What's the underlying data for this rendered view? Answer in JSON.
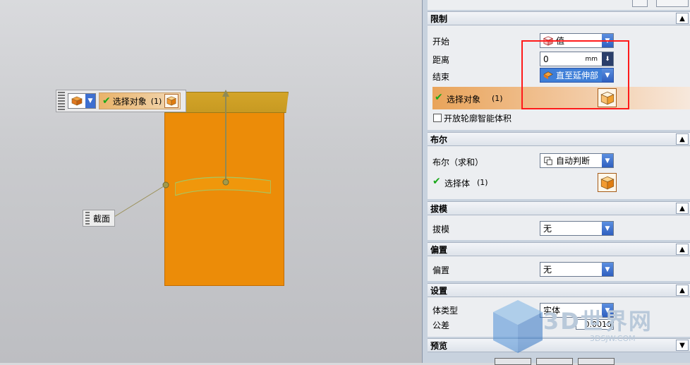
{
  "float_bar": {
    "select_label": "选择对象",
    "select_count": "(1)"
  },
  "section_tag": {
    "label": "截面"
  },
  "limits": {
    "title": "限制",
    "start_label": "开始",
    "start_value": "值",
    "distance_label": "距离",
    "distance_value": "0",
    "distance_unit": "mm",
    "end_label": "结束",
    "end_value": "直至延伸部",
    "select_label": "选择对象",
    "select_count": "(1)",
    "open_profile_label": "开放轮廓智能体积"
  },
  "boolean": {
    "title": "布尔",
    "bool_label": "布尔（求和）",
    "bool_value": "自动判断",
    "select_label": "选择体",
    "select_count": "(1)"
  },
  "draft": {
    "title": "拔模",
    "label": "拔模",
    "value": "无"
  },
  "offset": {
    "title": "偏置",
    "label": "偏置",
    "value": "无"
  },
  "settings": {
    "title": "设置",
    "body_type_label": "体类型",
    "body_type_value": "实体",
    "tolerance_label": "公差",
    "tolerance_value": "0.0010"
  },
  "preview": {
    "title": "预览"
  },
  "watermark": {
    "text": "3D世界网",
    "url": "3DSJW.COM"
  },
  "colors": {
    "accent": "#3f7fd8",
    "body": "#ec8c08",
    "highlight": "#ff1a1a"
  }
}
